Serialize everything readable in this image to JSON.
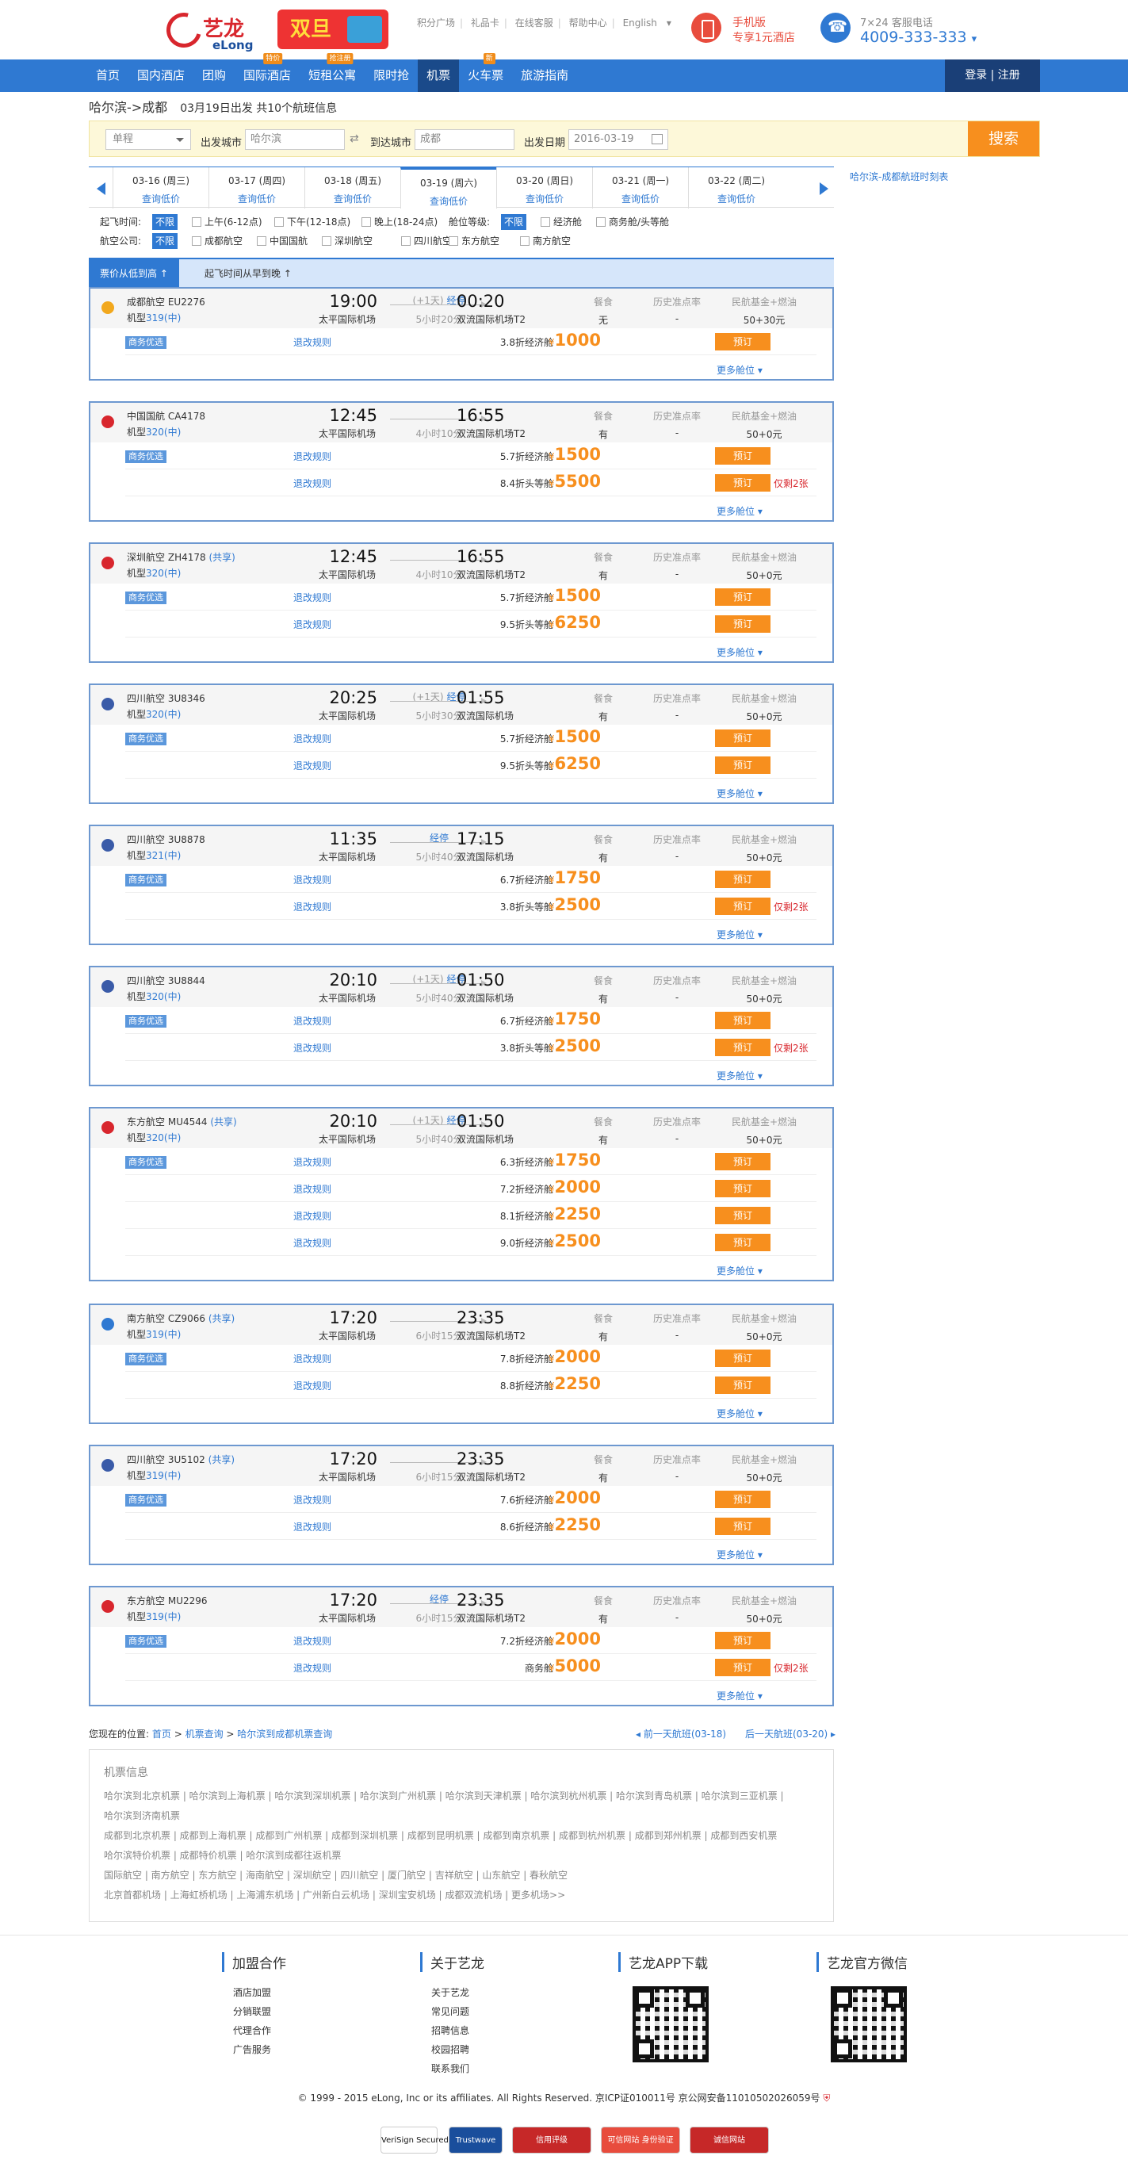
{
  "header": {
    "logo_cn": "艺龙",
    "logo_en": "eLong",
    "promo": "双旦",
    "links": [
      "积分广场",
      "礼品卡",
      "在线客服",
      "帮助中心",
      "English"
    ],
    "mobile_title": "手机版",
    "mobile_sub": "专享1元酒店",
    "phone_label": "7×24 客服电话",
    "phone_number": "4009-333-333"
  },
  "nav": {
    "items": [
      {
        "label": "首页"
      },
      {
        "label": "国内酒店"
      },
      {
        "label": "团购"
      },
      {
        "label": "国际酒店",
        "tag": "特价"
      },
      {
        "label": "短租公寓",
        "tag": "抢注册"
      },
      {
        "label": "限时抢"
      },
      {
        "label": "机票",
        "active": true
      },
      {
        "label": "火车票",
        "tag": "新"
      },
      {
        "label": "旅游指南"
      }
    ],
    "login": "登录 | 注册"
  },
  "route": {
    "title": "哈尔滨->成都",
    "sub": "03月19日出发 共10个航班信息"
  },
  "search": {
    "trip_type": "单程",
    "from_label": "出发城市",
    "from_value": "哈尔滨",
    "to_label": "到达城市",
    "to_value": "成都",
    "date_label": "出发日期",
    "date_value": "2016-03-19",
    "button": "搜索"
  },
  "dates": [
    {
      "date": "03-16 (周三)",
      "low": "查询低价"
    },
    {
      "date": "03-17 (周四)",
      "low": "查询低价"
    },
    {
      "date": "03-18 (周五)",
      "low": "查询低价"
    },
    {
      "date": "03-19 (周六)",
      "low": "查询低价",
      "active": true
    },
    {
      "date": "03-20 (周日)",
      "low": "查询低价"
    },
    {
      "date": "03-21 (周一)",
      "low": "查询低价"
    },
    {
      "date": "03-22 (周二)",
      "low": "查询低价"
    }
  ],
  "side_link": "哈尔滨-成都航班时刻表",
  "filters": {
    "time_label": "起飞时间:",
    "time_opts": [
      "不限",
      "上午(6-12点)",
      "下午(12-18点)",
      "晚上(18-24点)"
    ],
    "cabin_label": "舱位等级:",
    "cabin_opts": [
      "不限",
      "经济舱",
      "商务舱/头等舱"
    ],
    "airline_label": "航空公司:",
    "airline_opts": [
      "不限",
      "成都航空",
      "中国国航",
      "深圳航空",
      "四川航空",
      "东方航空",
      "南方航空"
    ]
  },
  "sort": {
    "price": "票价从低到高 ↑",
    "time": "起飞时间从早到晚 ↑"
  },
  "labels": {
    "meal": "餐食",
    "ontime": "历史准点率",
    "fund": "民航基金+燃油",
    "rule": "退改规则",
    "book": "预订",
    "more": "更多舱位",
    "yen": "¥",
    "biz_tag": "商务优选",
    "plus_day": "(+1天)",
    "stop": "经停"
  },
  "flights": [
    {
      "airline": "成都航空",
      "flight": "EU2276",
      "share": "",
      "plane": "319",
      "size": "(中)",
      "dep": "19:00",
      "dep_ap": "太平国际机场",
      "arr": "00:20",
      "arr_ap": "双流国际机场T2",
      "plus": true,
      "stop": true,
      "dur": "5小时20分",
      "meal": "无",
      "ontime": "-",
      "fund": "50+30元",
      "logo": "#f2a81d",
      "rows": [
        {
          "tag": true,
          "disc": "3.8折经济舱",
          "price": "1000",
          "left": ""
        }
      ]
    },
    {
      "airline": "中国国航",
      "flight": "CA4178",
      "share": "",
      "plane": "320",
      "size": "(中)",
      "dep": "12:45",
      "dep_ap": "太平国际机场",
      "arr": "16:55",
      "arr_ap": "双流国际机场T2",
      "plus": false,
      "stop": false,
      "dur": "4小时10分",
      "meal": "有",
      "ontime": "-",
      "fund": "50+0元",
      "logo": "#d8262d",
      "rows": [
        {
          "tag": true,
          "disc": "5.7折经济舱",
          "price": "1500",
          "left": ""
        },
        {
          "tag": false,
          "disc": "8.4折头等舱",
          "price": "5500",
          "left": "仅剩2张"
        }
      ]
    },
    {
      "airline": "深圳航空",
      "flight": "ZH4178",
      "share": "(共享)",
      "plane": "320",
      "size": "(中)",
      "dep": "12:45",
      "dep_ap": "太平国际机场",
      "arr": "16:55",
      "arr_ap": "双流国际机场T2",
      "plus": false,
      "stop": false,
      "dur": "4小时10分",
      "meal": "有",
      "ontime": "-",
      "fund": "50+0元",
      "logo": "#d8262d",
      "rows": [
        {
          "tag": true,
          "disc": "5.7折经济舱",
          "price": "1500",
          "left": ""
        },
        {
          "tag": false,
          "disc": "9.5折头等舱",
          "price": "6250",
          "left": ""
        }
      ]
    },
    {
      "airline": "四川航空",
      "flight": "3U8346",
      "share": "",
      "plane": "320",
      "size": "(中)",
      "dep": "20:25",
      "dep_ap": "太平国际机场",
      "arr": "01:55",
      "arr_ap": "双流国际机场",
      "plus": true,
      "stop": true,
      "dur": "5小时30分",
      "meal": "有",
      "ontime": "-",
      "fund": "50+0元",
      "logo": "#3a5ba8",
      "rows": [
        {
          "tag": true,
          "disc": "5.7折经济舱",
          "price": "1500",
          "left": ""
        },
        {
          "tag": false,
          "disc": "9.5折头等舱",
          "price": "6250",
          "left": ""
        }
      ]
    },
    {
      "airline": "四川航空",
      "flight": "3U8878",
      "share": "",
      "plane": "321",
      "size": "(中)",
      "dep": "11:35",
      "dep_ap": "太平国际机场",
      "arr": "17:15",
      "arr_ap": "双流国际机场",
      "plus": false,
      "stop": true,
      "dur": "5小时40分",
      "meal": "有",
      "ontime": "-",
      "fund": "50+0元",
      "logo": "#3a5ba8",
      "rows": [
        {
          "tag": true,
          "disc": "6.7折经济舱",
          "price": "1750",
          "left": ""
        },
        {
          "tag": false,
          "disc": "3.8折头等舱",
          "price": "2500",
          "left": "仅剩2张"
        }
      ]
    },
    {
      "airline": "四川航空",
      "flight": "3U8844",
      "share": "",
      "plane": "320",
      "size": "(中)",
      "dep": "20:10",
      "dep_ap": "太平国际机场",
      "arr": "01:50",
      "arr_ap": "双流国际机场",
      "plus": true,
      "stop": true,
      "dur": "5小时40分",
      "meal": "有",
      "ontime": "-",
      "fund": "50+0元",
      "logo": "#3a5ba8",
      "rows": [
        {
          "tag": true,
          "disc": "6.7折经济舱",
          "price": "1750",
          "left": ""
        },
        {
          "tag": false,
          "disc": "3.8折头等舱",
          "price": "2500",
          "left": "仅剩2张"
        }
      ]
    },
    {
      "airline": "东方航空",
      "flight": "MU4544",
      "share": "(共享)",
      "plane": "320",
      "size": "(中)",
      "dep": "20:10",
      "dep_ap": "太平国际机场",
      "arr": "01:50",
      "arr_ap": "双流国际机场",
      "plus": true,
      "stop": true,
      "dur": "5小时40分",
      "meal": "有",
      "ontime": "-",
      "fund": "50+0元",
      "logo": "#d8262d",
      "rows": [
        {
          "tag": true,
          "disc": "6.3折经济舱",
          "price": "1750",
          "left": ""
        },
        {
          "tag": false,
          "disc": "7.2折经济舱",
          "price": "2000",
          "left": ""
        },
        {
          "tag": false,
          "disc": "8.1折经济舱",
          "price": "2250",
          "left": ""
        },
        {
          "tag": false,
          "disc": "9.0折经济舱",
          "price": "2500",
          "left": ""
        }
      ]
    },
    {
      "airline": "南方航空",
      "flight": "CZ9066",
      "share": "(共享)",
      "plane": "319",
      "size": "(中)",
      "dep": "17:20",
      "dep_ap": "太平国际机场",
      "arr": "23:35",
      "arr_ap": "双流国际机场T2",
      "plus": false,
      "stop": false,
      "dur": "6小时15分",
      "meal": "有",
      "ontime": "-",
      "fund": "50+0元",
      "logo": "#2f79d2",
      "rows": [
        {
          "tag": true,
          "disc": "7.8折经济舱",
          "price": "2000",
          "left": ""
        },
        {
          "tag": false,
          "disc": "8.8折经济舱",
          "price": "2250",
          "left": ""
        }
      ]
    },
    {
      "airline": "四川航空",
      "flight": "3U5102",
      "share": "(共享)",
      "plane": "319",
      "size": "(中)",
      "dep": "17:20",
      "dep_ap": "太平国际机场",
      "arr": "23:35",
      "arr_ap": "双流国际机场T2",
      "plus": false,
      "stop": false,
      "dur": "6小时15分",
      "meal": "有",
      "ontime": "-",
      "fund": "50+0元",
      "logo": "#3a5ba8",
      "rows": [
        {
          "tag": true,
          "disc": "7.6折经济舱",
          "price": "2000",
          "left": ""
        },
        {
          "tag": false,
          "disc": "8.6折经济舱",
          "price": "2250",
          "left": ""
        }
      ]
    },
    {
      "airline": "东方航空",
      "flight": "MU2296",
      "share": "",
      "plane": "319",
      "size": "(中)",
      "dep": "17:20",
      "dep_ap": "太平国际机场",
      "arr": "23:35",
      "arr_ap": "双流国际机场T2",
      "plus": false,
      "stop": true,
      "dur": "6小时15分",
      "meal": "有",
      "ontime": "-",
      "fund": "50+0元",
      "logo": "#d8262d",
      "rows": [
        {
          "tag": true,
          "disc": "7.2折经济舱",
          "price": "2000",
          "left": ""
        },
        {
          "tag": false,
          "disc": "商务舱",
          "price": "5000",
          "left": "仅剩2张"
        }
      ]
    }
  ],
  "crumbs": {
    "prefix": "您现在的位置:",
    "home": "首页",
    "query": "机票查询",
    "current": "哈尔滨到成都机票查询",
    "prev": "◂ 前一天航班(03-18)",
    "next": "后一天航班(03-20) ▸"
  },
  "seo": {
    "title": "机票信息",
    "lines": [
      "哈尔滨到北京机票 | 哈尔滨到上海机票 | 哈尔滨到深圳机票 | 哈尔滨到广州机票 | 哈尔滨到天津机票 | 哈尔滨到杭州机票 | 哈尔滨到青岛机票 | 哈尔滨到三亚机票 |",
      "哈尔滨到济南机票",
      "成都到北京机票 | 成都到上海机票 | 成都到广州机票 | 成都到深圳机票 | 成都到昆明机票 | 成都到南京机票 | 成都到杭州机票 | 成都到郑州机票 | 成都到西安机票",
      "哈尔滨特价机票 | 成都特价机票 | 哈尔滨到成都往返机票",
      "国际航空 | 南方航空 | 东方航空 | 海南航空 | 深圳航空 | 四川航空 | 厦门航空 | 吉祥航空 | 山东航空 | 春秋航空",
      "北京首都机场 | 上海虹桥机场 | 上海浦东机场 | 广州新白云机场 | 深圳宝安机场 | 成都双流机场 | 更多机场>>"
    ]
  },
  "footer": {
    "cols": [
      {
        "title": "加盟合作",
        "items": [
          "酒店加盟",
          "分销联盟",
          "代理合作",
          "广告服务"
        ]
      },
      {
        "title": "关于艺龙",
        "items": [
          "关于艺龙",
          "常见问题",
          "招聘信息",
          "校园招聘",
          "联系我们"
        ]
      },
      {
        "title": "艺龙APP下载",
        "items": []
      },
      {
        "title": "艺龙官方微信",
        "items": []
      }
    ],
    "copyright": "© 1999 - 2015 eLong, Inc or its affiliates. All Rights Reserved. 京ICP证010011号 京公网安备11010502026059号",
    "badges": [
      "VeriSign Secured",
      "Trustwave",
      "信用评级",
      "可信网站 身份验证",
      "诚信网站"
    ]
  }
}
